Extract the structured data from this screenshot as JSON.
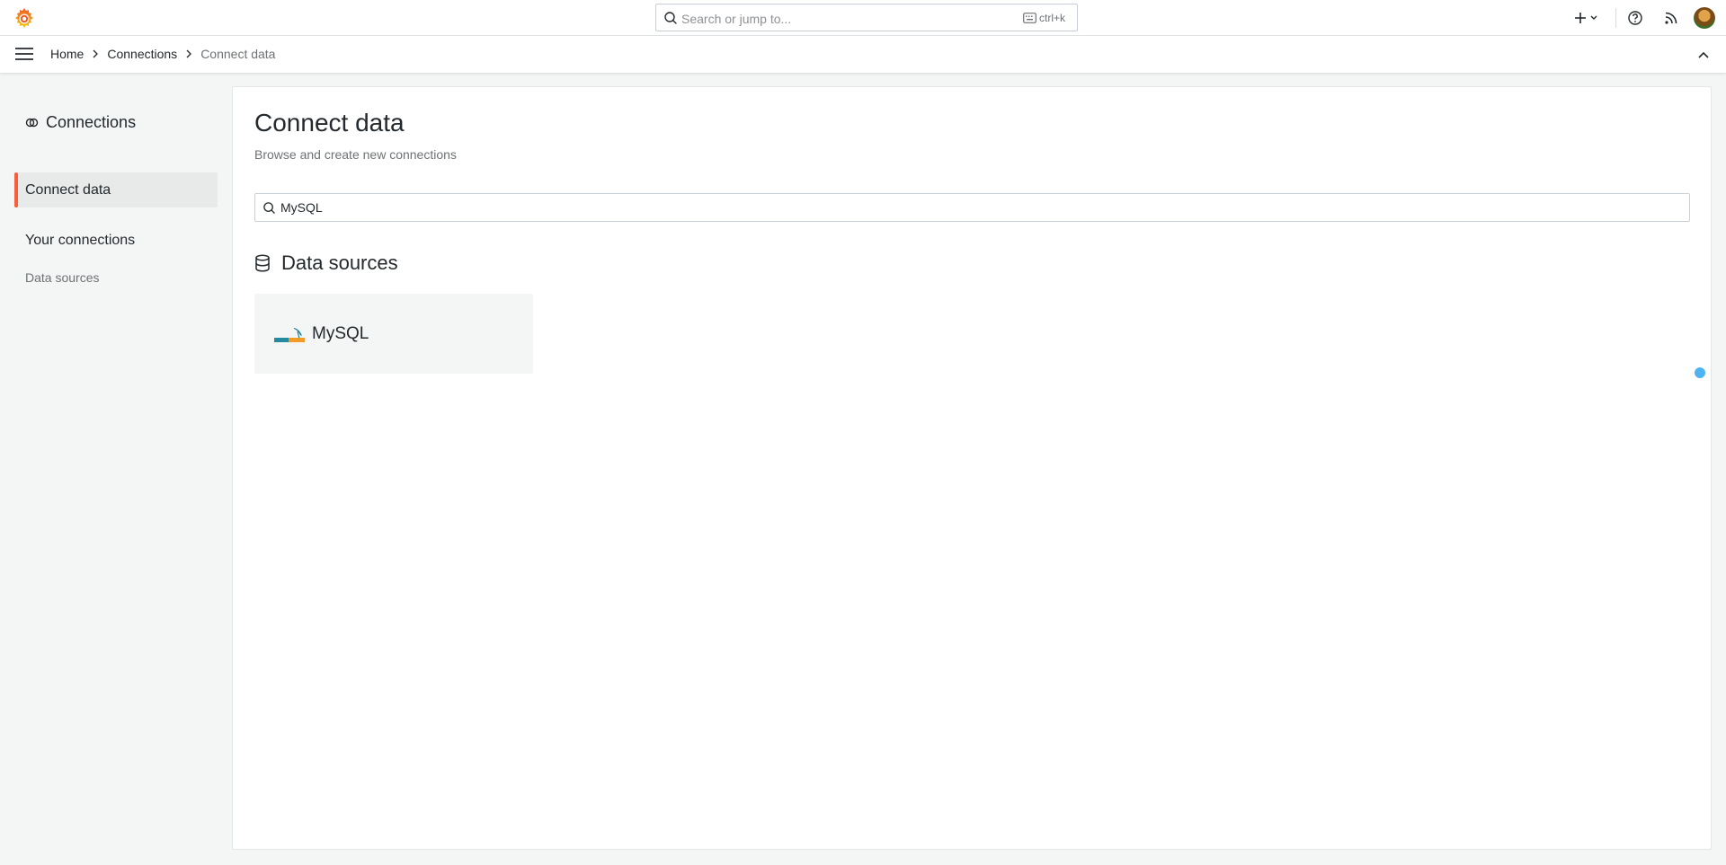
{
  "topbar": {
    "search_placeholder": "Search or jump to...",
    "shortcut": "ctrl+k"
  },
  "breadcrumb": {
    "items": [
      "Home",
      "Connections",
      "Connect data"
    ]
  },
  "sidebar": {
    "title": "Connections",
    "active_item": "Connect data",
    "group_label": "Your connections",
    "sub_item": "Data sources"
  },
  "main": {
    "title": "Connect data",
    "subtitle": "Browse and create new connections",
    "filter_value": "MySQL",
    "section_title": "Data sources",
    "cards": [
      {
        "label": "MySQL",
        "logo": "mysql-logo"
      }
    ]
  },
  "colors": {
    "accent": "#f55f3e",
    "cursor": "#4fb3f0"
  }
}
